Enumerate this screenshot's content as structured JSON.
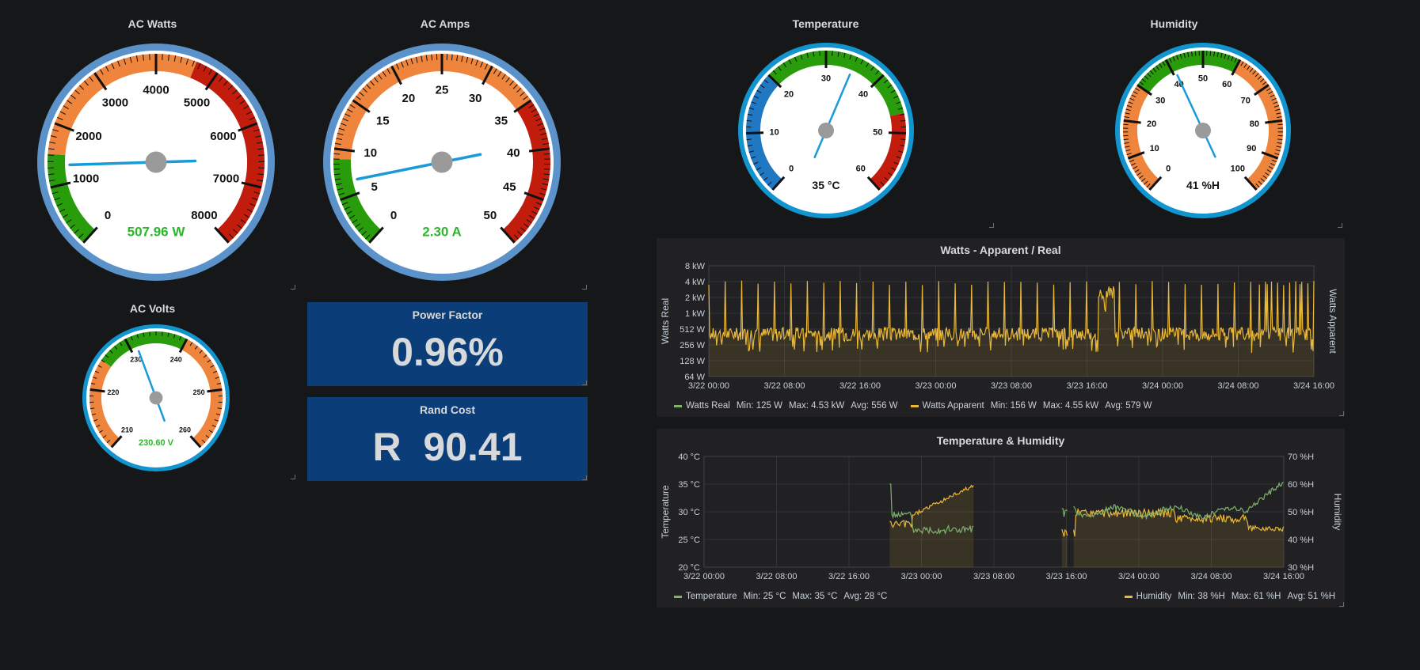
{
  "colors": {
    "background": "#161719",
    "panel": "#212124",
    "stat_bg": "#0b3d79",
    "green": "#299c0c",
    "orange": "#ef843c",
    "red": "#c11c0c",
    "bright_red": "#f2495c",
    "blue_band": "#1f78c1",
    "needle": "#1a9bd7",
    "value_green": "#2bb62b",
    "series_green": "#7eb26d",
    "series_yellow": "#eab839"
  },
  "gauges": {
    "ac_watts": {
      "title": "AC Watts",
      "value_text": "507.96 W",
      "value": 507.96,
      "min": -1000,
      "max": 8000,
      "ticks": [
        "0",
        "1000",
        "2000",
        "3000",
        "4000",
        "5000",
        "6000",
        "7000",
        "8000"
      ],
      "bands": [
        "green",
        "orange",
        "red"
      ],
      "rim_color": "#5b92c9"
    },
    "ac_amps": {
      "title": "AC Amps",
      "value_text": "2.30 A",
      "value": 2.3,
      "min": -5,
      "max": 50,
      "ticks": [
        "0",
        "5",
        "10",
        "15",
        "20",
        "25",
        "30",
        "35",
        "40",
        "45",
        "50"
      ],
      "bands": [
        "green",
        "orange",
        "red"
      ],
      "rim_color": "#5b92c9"
    },
    "temperature": {
      "title": "Temperature",
      "value_text": "35 °C",
      "value": 35,
      "min": 0,
      "max": 60,
      "ticks": [
        "0",
        "10",
        "20",
        "30",
        "40",
        "50",
        "60"
      ],
      "bands": [
        "blue",
        "green",
        "red"
      ],
      "rim_color": "#1294cf"
    },
    "humidity": {
      "title": "Humidity",
      "value_text": "41 %H",
      "value": 41,
      "min": 0,
      "max": 100,
      "ticks": [
        "0",
        "10",
        "20",
        "30",
        "40",
        "50",
        "60",
        "70",
        "80",
        "90",
        "100"
      ],
      "bands": [
        "orange",
        "green",
        "orange"
      ],
      "rim_color": "#1294cf"
    },
    "ac_volts": {
      "title": "AC Volts",
      "value_text": "230.60 V",
      "value": 230.6,
      "min": 205,
      "max": 265,
      "ticks": [
        "210",
        "220",
        "230",
        "240",
        "250",
        "260"
      ],
      "bands": [
        "orange",
        "green",
        "orange"
      ],
      "rim_color": "#1294cf"
    }
  },
  "stats": {
    "power_factor": {
      "title": "Power Factor",
      "value": "0.96%"
    },
    "rand_cost": {
      "title": "Rand Cost",
      "value": "R  90.41"
    }
  },
  "chart_data": [
    {
      "type": "line",
      "title": "Watts - Apparent / Real",
      "ylabel": "Watts Real",
      "y2label": "Watts Apparent",
      "y_ticks": [
        "8 kW",
        "4 kW",
        "2 kW",
        "1 kW",
        "512 W",
        "256 W",
        "128 W",
        "64 W"
      ],
      "y_scale": "log2",
      "x_ticks": [
        "3/22 00:00",
        "3/22 08:00",
        "3/22 16:00",
        "3/23 00:00",
        "3/23 08:00",
        "3/23 16:00",
        "3/24 00:00",
        "3/24 08:00",
        "3/24 16:00"
      ],
      "series": [
        {
          "name": "Watts Real",
          "color": "#7eb26d",
          "min": "125 W",
          "max": "4.53 kW",
          "avg": "556 W"
        },
        {
          "name": "Watts Apparent",
          "color": "#eab839",
          "min": "156 W",
          "max": "4.55 kW",
          "avg": "579 W"
        }
      ],
      "legend": {
        "real": {
          "label": "Watts Real",
          "min": "Min: 125 W",
          "max": "Max: 4.53 kW",
          "avg": "Avg: 556 W"
        },
        "apparent": {
          "label": "Watts Apparent",
          "min": "Min: 156 W",
          "max": "Max: 4.55 kW",
          "avg": "Avg: 579 W"
        }
      },
      "grid": true
    },
    {
      "type": "line",
      "title": "Temperature & Humidity",
      "ylabel": "Temperature",
      "y2label": "Humidity",
      "y_ticks": [
        "40 °C",
        "35 °C",
        "30 °C",
        "25 °C",
        "20 °C"
      ],
      "y2_ticks": [
        "70 %H",
        "60 %H",
        "50 %H",
        "40 %H",
        "30 %H"
      ],
      "x_ticks": [
        "3/22 00:00",
        "3/22 08:00",
        "3/22 16:00",
        "3/23 00:00",
        "3/23 08:00",
        "3/23 16:00",
        "3/24 00:00",
        "3/24 08:00",
        "3/24 16:00"
      ],
      "series": [
        {
          "name": "Temperature",
          "color": "#7eb26d",
          "min": "25 °C",
          "max": "35 °C",
          "avg": "28 °C"
        },
        {
          "name": "Humidity",
          "color": "#eab839",
          "min": "38 %H",
          "max": "61 %H",
          "avg": "51 %H"
        }
      ],
      "legend": {
        "temperature": {
          "label": "Temperature",
          "min": "Min: 25 °C",
          "max": "Max: 35 °C",
          "avg": "Avg: 28 °C"
        },
        "humidity": {
          "label": "Humidity",
          "min": "Min: 38 %H",
          "max": "Max: 61 %H",
          "avg": "Avg: 51 %H"
        }
      },
      "grid": true
    }
  ]
}
